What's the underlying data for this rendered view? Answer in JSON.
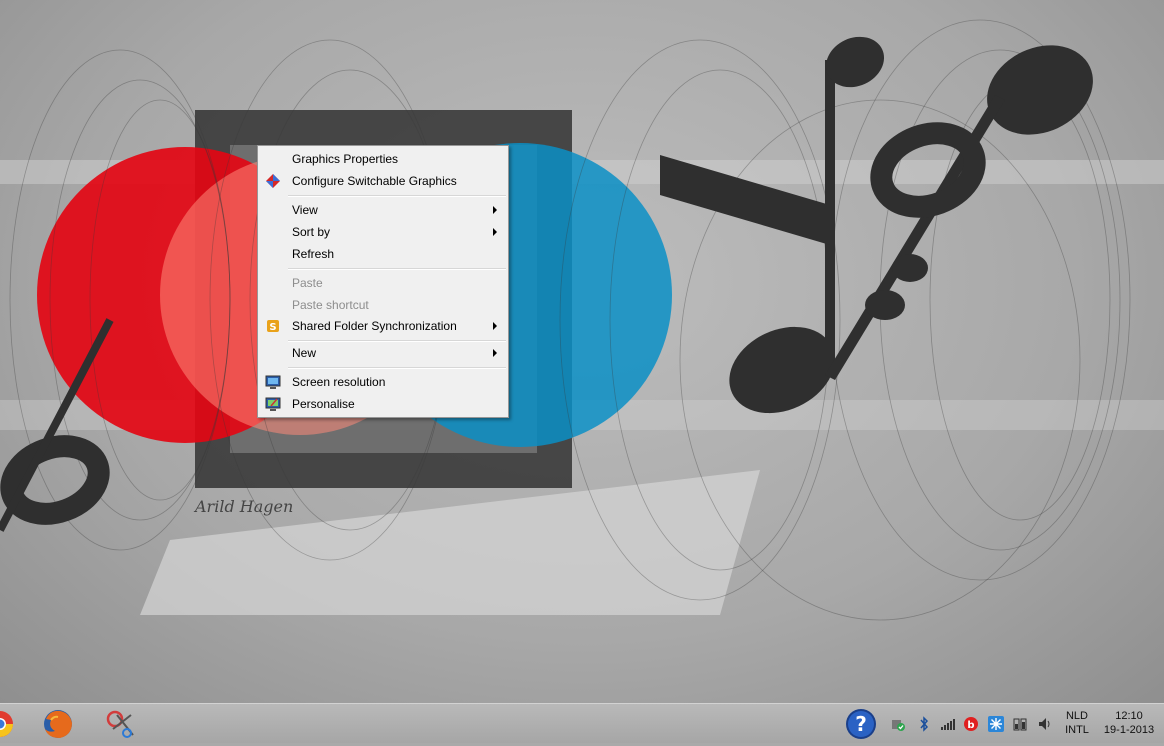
{
  "wallpaper": {
    "signature": "Arild Hagen",
    "colors": {
      "red": "#e30613",
      "blue": "#0a8fc6",
      "dark": "#2f2f2f"
    }
  },
  "context_menu": {
    "items": [
      {
        "label": "Graphics Properties",
        "icon": "none",
        "disabled": false,
        "submenu": false
      },
      {
        "label": "Configure Switchable Graphics",
        "icon": "switchable-graphics-icon",
        "disabled": false,
        "submenu": false
      },
      {
        "label": "View",
        "disabled": false,
        "submenu": true
      },
      {
        "label": "Sort by",
        "disabled": false,
        "submenu": true
      },
      {
        "label": "Refresh",
        "disabled": false,
        "submenu": false
      },
      {
        "label": "Paste",
        "disabled": true,
        "submenu": false
      },
      {
        "label": "Paste shortcut",
        "disabled": true,
        "submenu": false
      },
      {
        "label": "Shared Folder Synchronization",
        "icon": "shared-folder-sync-icon",
        "disabled": false,
        "submenu": true
      },
      {
        "label": "New",
        "disabled": false,
        "submenu": true
      },
      {
        "label": "Screen resolution",
        "icon": "screen-resolution-icon",
        "disabled": false,
        "submenu": false
      },
      {
        "label": "Personalise",
        "icon": "personalise-icon",
        "disabled": false,
        "submenu": false
      }
    ]
  },
  "taskbar": {
    "pinned": [
      "chrome-icon",
      "firefox-icon",
      "snipping-tool-icon"
    ],
    "tray_icons": [
      "help-icon",
      "network-adapter-icon",
      "bluetooth-icon",
      "signal-bars-icon",
      "beats-audio-icon",
      "snowflake-icon",
      "power-icon",
      "volume-icon"
    ],
    "language": {
      "top": "NLD",
      "bottom": "INTL"
    },
    "clock": {
      "time": "12:10",
      "date": "19-1-2013"
    }
  }
}
